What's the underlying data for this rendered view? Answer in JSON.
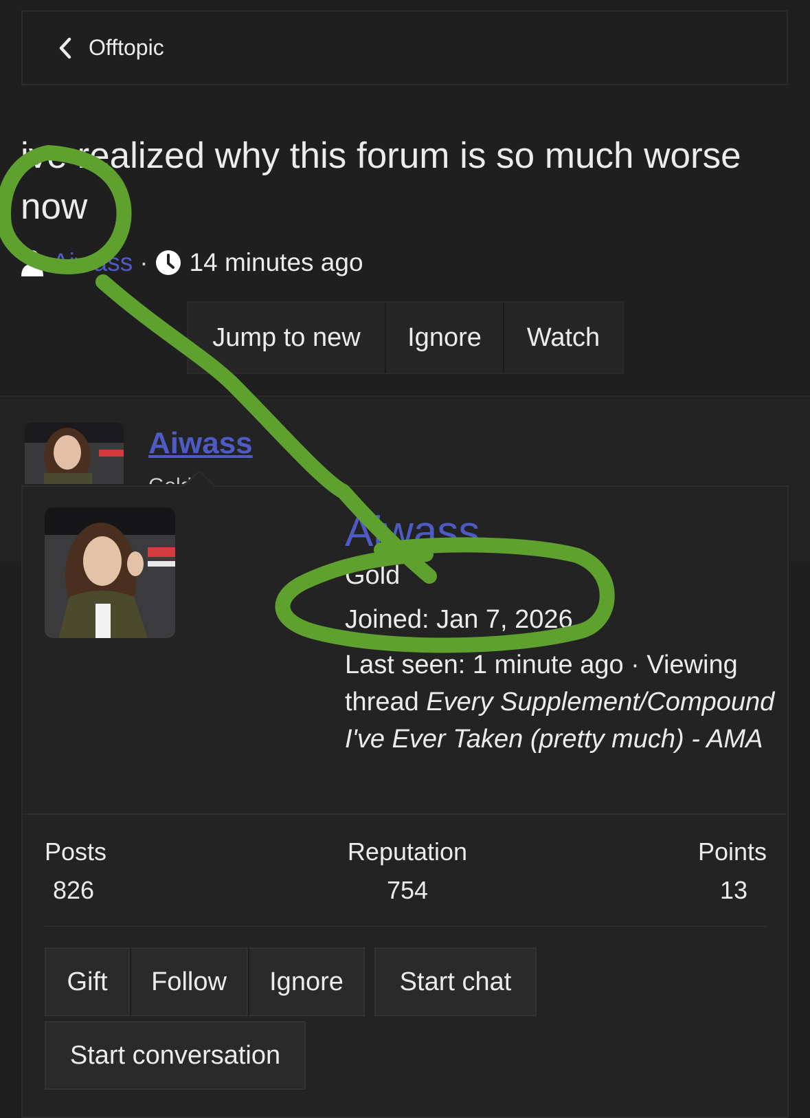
{
  "breadcrumb": {
    "label": "Offtopic"
  },
  "thread": {
    "title": "ive realized why this forum is so much worse now",
    "author": "Aiwass",
    "separator": "·",
    "time": "14 minutes ago"
  },
  "thread_actions": [
    {
      "label": "Jump to new"
    },
    {
      "label": "Ignore"
    },
    {
      "label": "Watch"
    }
  ],
  "post": {
    "author": "Aiwass",
    "subtitle": "Gold"
  },
  "profile_card": {
    "name": "Aiwass",
    "rank": "Gold",
    "joined": "Joined: Jan 7, 2026",
    "last_seen_prefix": "Last seen: 1 minute ago · Viewing thread",
    "last_seen_thread": "Every Supplement/Compound I've Ever Taken (pretty much) - AMA",
    "stats": {
      "posts_label": "Posts",
      "posts_value": "826",
      "reputation_label": "Reputation",
      "reputation_value": "754",
      "points_label": "Points",
      "points_value": "13"
    },
    "buttons": {
      "gift": "Gift",
      "follow": "Follow",
      "ignore": "Ignore",
      "start_chat": "Start chat",
      "start_conversation": "Start conversation"
    }
  },
  "colors": {
    "background": "#1f1f1f",
    "link": "#4f5bc4",
    "annotation": "#5fa12f"
  },
  "icons": {
    "back": "chevron-left-icon",
    "user": "user-icon",
    "clock": "clock-icon"
  }
}
